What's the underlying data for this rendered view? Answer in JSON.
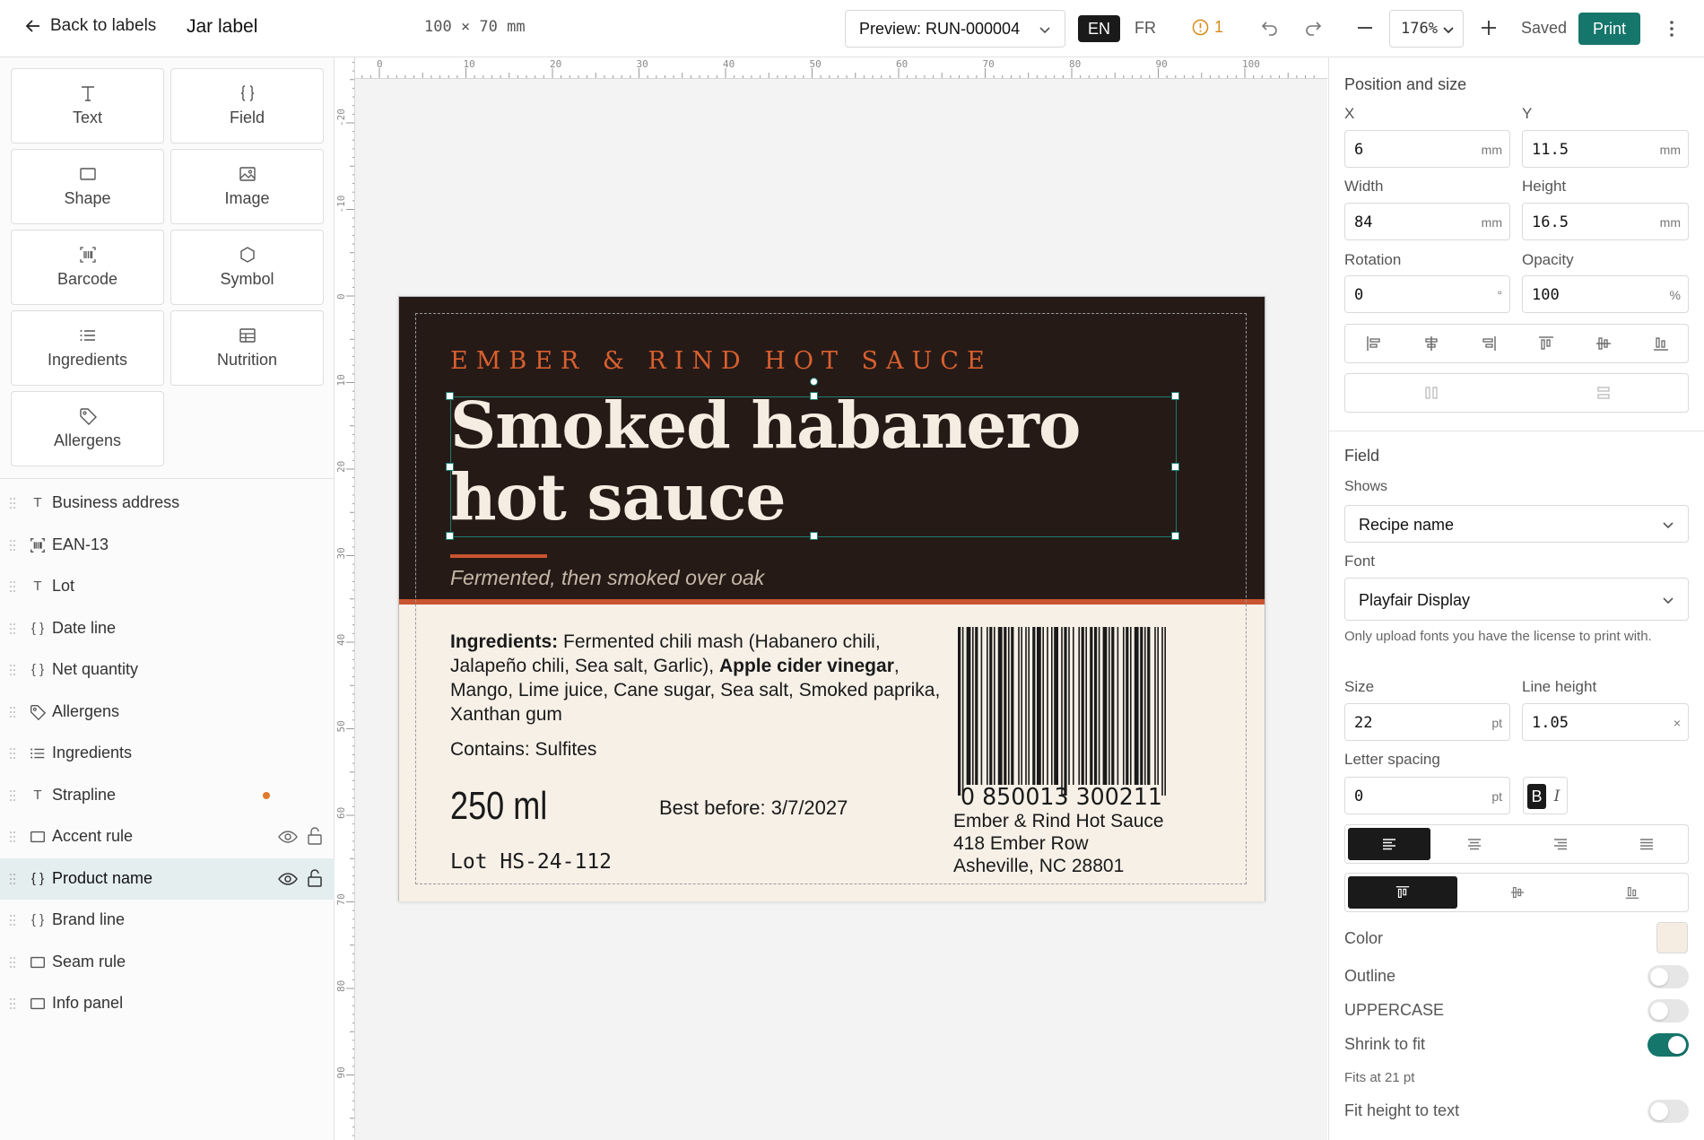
{
  "topbar": {
    "back_label": "Back to labels",
    "title": "Jar label",
    "dimensions": "100 × 70 mm",
    "preview_select": "Preview: RUN-000004",
    "lang_en": "EN",
    "lang_fr": "FR",
    "warnings_count": "1",
    "zoom": "176%",
    "save_status": "Saved",
    "print_label": "Print"
  },
  "tools": [
    {
      "label": "Text",
      "icon": "text-icon"
    },
    {
      "label": "Field",
      "icon": "braces-icon"
    },
    {
      "label": "Shape",
      "icon": "square-icon"
    },
    {
      "label": "Image",
      "icon": "image-icon"
    },
    {
      "label": "Barcode",
      "icon": "barcode-icon"
    },
    {
      "label": "Symbol",
      "icon": "symbol-icon"
    },
    {
      "label": "Ingredients",
      "icon": "list-icon"
    },
    {
      "label": "Nutrition",
      "icon": "table-icon"
    },
    {
      "label": "Allergens",
      "icon": "tag-icon"
    }
  ],
  "layers": [
    {
      "name": "Business address",
      "icon": "T"
    },
    {
      "name": "EAN-13",
      "icon": "barcode"
    },
    {
      "name": "Lot",
      "icon": "T"
    },
    {
      "name": "Date line",
      "icon": "{ }"
    },
    {
      "name": "Net quantity",
      "icon": "{ }"
    },
    {
      "name": "Allergens",
      "icon": "tag"
    },
    {
      "name": "Ingredients",
      "icon": "list"
    },
    {
      "name": "Strapline",
      "icon": "T"
    },
    {
      "name": "Accent rule",
      "icon": "square"
    },
    {
      "name": "Product name",
      "icon": "{ }"
    },
    {
      "name": "Brand line",
      "icon": "{ }"
    },
    {
      "name": "Seam rule",
      "icon": "square"
    },
    {
      "name": "Info panel",
      "icon": "square"
    }
  ],
  "ruler": {
    "top": [
      "0",
      "10",
      "20",
      "30",
      "40",
      "50",
      "60",
      "70",
      "80",
      "90",
      "100"
    ],
    "left": [
      "-20",
      "-10",
      "0",
      "10",
      "20",
      "30",
      "40",
      "50",
      "60",
      "70",
      "80",
      "90"
    ]
  },
  "label": {
    "brand": "EMBER & RIND HOT SAUCE",
    "product_name": "Smoked habanero hot sauce",
    "strapline": "Fermented, then smoked over oak",
    "ingredients_prefix": "Ingredients:",
    "ingredients_part1": " Fermented chili mash (Habanero chili, Jalapeño chili, Sea salt, Garlic), ",
    "ingredients_bold": "Apple cider vinegar",
    "ingredients_part2": ", Mango, Lime juice, Cane sugar, Sea salt, Smoked paprika, Xanthan gum",
    "contains": "Contains: Sulfites",
    "net_quantity": "250 ml",
    "best_before": "Best before: 3/7/2027",
    "lot": "Lot HS-24-112",
    "barcode_digits": "0 850013 300211",
    "address_line1": "Ember & Rind Hot Sauce",
    "address_line2": "418 Ember Row",
    "address_line3": "Asheville, NC 28801",
    "colors": {
      "dark": "#261a17",
      "accent": "#c95431",
      "brand": "#d8602f",
      "panel": "#f6f0e7"
    }
  },
  "inspector": {
    "position_title": "Position and size",
    "x_label": "X",
    "x_value": "6",
    "y_label": "Y",
    "y_value": "11.5",
    "width_label": "Width",
    "width_value": "84",
    "height_label": "Height",
    "height_value": "16.5",
    "rotation_label": "Rotation",
    "rotation_value": "0",
    "opacity_label": "Opacity",
    "opacity_value": "100",
    "unit_mm": "mm",
    "unit_deg": "°",
    "unit_pct": "%",
    "unit_pt": "pt",
    "unit_x": "×",
    "field_title": "Field",
    "shows_label": "Shows",
    "shows_value": "Recipe name",
    "font_label": "Font",
    "font_value": "Playfair Display",
    "font_hint": "Only upload fonts you have the license to print with.",
    "size_label": "Size",
    "size_value": "22",
    "line_height_label": "Line height",
    "line_height_value": "1.05",
    "letter_spacing_label": "Letter spacing",
    "letter_spacing_value": "0",
    "bold_label": "B",
    "italic_label": "I",
    "color_label": "Color",
    "color_value": "#f5ede2",
    "outline_label": "Outline",
    "outline_on": false,
    "uppercase_label": "UPPERCASE",
    "uppercase_on": false,
    "shrink_label": "Shrink to fit",
    "shrink_on": true,
    "fits_text": "Fits at 21 pt",
    "fit_height_label": "Fit height to text",
    "fit_height_on": false
  }
}
